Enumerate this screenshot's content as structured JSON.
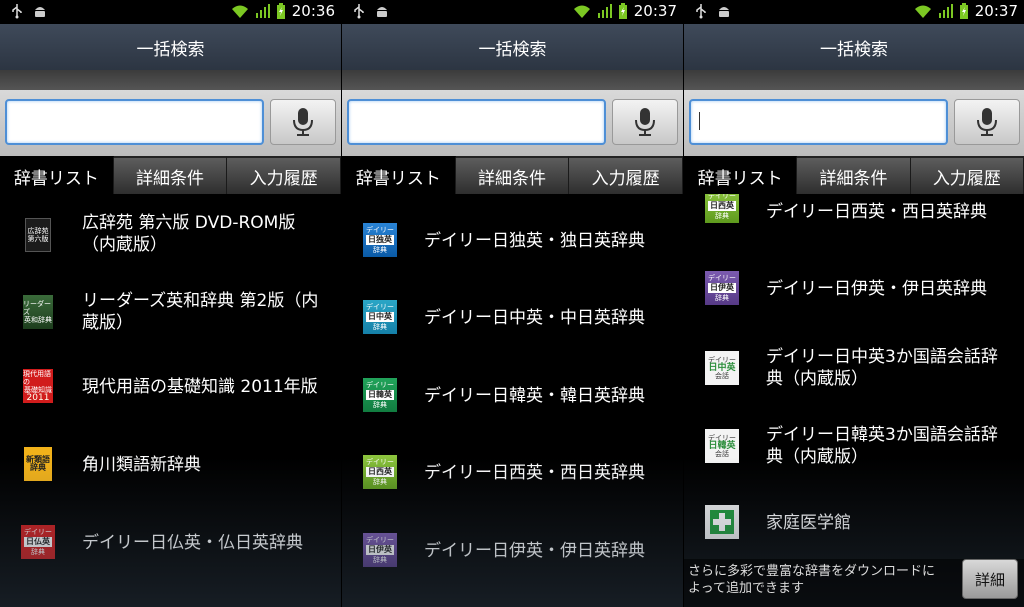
{
  "status": {
    "times": [
      "20:36",
      "20:37",
      "20:37"
    ]
  },
  "title": "一括検索",
  "search": {
    "value": "",
    "placeholder": ""
  },
  "tabs": [
    "辞書リスト",
    "詳細条件",
    "入力履歴"
  ],
  "panel1_items": [
    {
      "label": "広辞苑 第六版 DVD-ROM版（内蔵版）",
      "icon": "kojien-book-icon"
    },
    {
      "label": "リーダーズ英和辞典 第2版（内蔵版）",
      "icon": "readers-book-icon"
    },
    {
      "label": "現代用語の基礎知識 2011年版",
      "icon": "gendai-yougo-book-icon"
    },
    {
      "label": "角川類語新辞典",
      "icon": "kadokawa-ruigo-book-icon"
    },
    {
      "label": "デイリー日仏英・仏日英辞典",
      "icon": "daily-french-book-icon"
    }
  ],
  "panel2_items": [
    {
      "label": "デイリー日独英・独日英辞典",
      "icon": "daily-german-book-icon"
    },
    {
      "label": "デイリー日中英・中日英辞典",
      "icon": "daily-chinese-book-icon"
    },
    {
      "label": "デイリー日韓英・韓日英辞典",
      "icon": "daily-korean-book-icon"
    },
    {
      "label": "デイリー日西英・西日英辞典",
      "icon": "daily-spanish-book-icon"
    },
    {
      "label": "デイリー日伊英・伊日英辞典",
      "icon": "daily-italian-book-icon"
    }
  ],
  "panel3_items": [
    {
      "label": "デイリー日西英・西日英辞典",
      "icon": "daily-spanish-book-icon"
    },
    {
      "label": "デイリー日伊英・伊日英辞典",
      "icon": "daily-italian-book-icon"
    },
    {
      "label": "デイリー日中英3か国語会話辞典（内蔵版）",
      "icon": "daily-chinese-conversation-book-icon"
    },
    {
      "label": "デイリー日韓英3か国語会話辞典（内蔵版）",
      "icon": "daily-korean-conversation-book-icon"
    },
    {
      "label": "家庭医学館",
      "icon": "katei-igakukan-book-icon"
    }
  ],
  "covers": {
    "kojien": "広辞苑",
    "kojien_sub": "第六版",
    "readers": "リーダーズ",
    "readers_sub": "英和辞典",
    "gendai": "現代用語の",
    "gendai_sub": "基礎知識",
    "gendai_year": "2011",
    "kadokawa": "新類語",
    "kadokawa_sub": "辞典",
    "daily": "デイリー",
    "jiten": "辞典",
    "kaiwa": "会話",
    "fr": "日仏英",
    "de": "日独英",
    "zh": "日中英",
    "ko": "日韓英",
    "es": "日西英",
    "it": "日伊英",
    "zh_conv": "日中英",
    "ko_conv": "日韓英"
  },
  "footer": {
    "text": "さらに多彩で豊富な辞書をダウンロードによって追加できます",
    "button": "詳細"
  },
  "colors": {
    "title_bar": "#36404e",
    "input_border": "#4e8fd6"
  }
}
